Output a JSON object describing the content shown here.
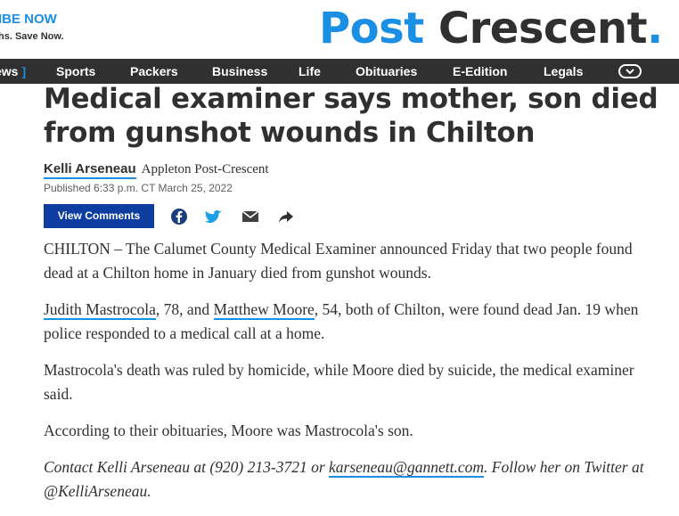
{
  "promo": {
    "line1": "IBE NOW",
    "line2": "hs. Save Now."
  },
  "logo": {
    "word1": "Post",
    "word2": "Crescent",
    "dot": "."
  },
  "nav": {
    "items": [
      "ews",
      "Sports",
      "Packers",
      "Business",
      "Life",
      "Obituaries",
      "E-Edition",
      "Legals"
    ],
    "bracket": "]",
    "more_icon": "chevron-down-icon"
  },
  "article": {
    "headline": "Medical examiner says mother, son died from gunshot wounds in Chilton",
    "author": "Kelli Arseneau",
    "outlet": "Appleton Post-Crescent",
    "published": "Published 6:33 p.m. CT March 25, 2022",
    "view_comments": "View Comments",
    "share_icons": [
      "facebook-icon",
      "twitter-icon",
      "email-icon",
      "share-icon"
    ],
    "p1": "CHILTON – The Calumet County Medical Examiner announced Friday that two people found dead at a Chilton home in January died from gunshot wounds.",
    "p2_link1": "Judith Mastrocola",
    "p2_mid": ", 78, and ",
    "p2_link2": "Matthew Moore",
    "p2_rest": ", 54, both of Chilton, were found dead Jan. 19 when police responded to a medical call at a home.",
    "p3": "Mastrocola's death was ruled by homicide, while Moore died by suicide, the medical examiner said.",
    "p4": "According to their obituaries, Moore was Mastrocola's son.",
    "contact_pre": "Contact Kelli Arseneau at (920) 213-3721 or ",
    "contact_email": "karseneau@gannett.com",
    "contact_post": ". Follow her on Twitter at @KelliArseneau."
  },
  "colors": {
    "brand_blue": "#1a8fe3",
    "nav_bg": "#303030",
    "button_blue": "#0d3d9e"
  }
}
